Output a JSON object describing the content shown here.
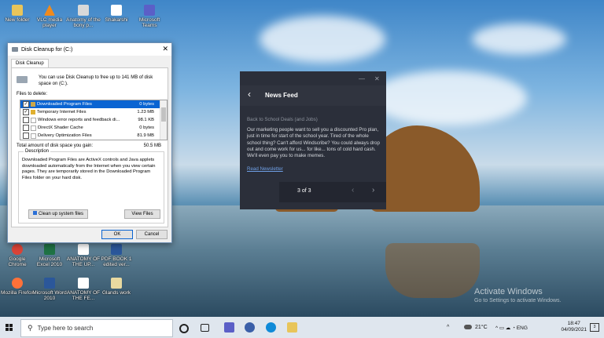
{
  "desktop": {
    "icons_row1": [
      {
        "label": "New folder",
        "color": "#e8c55a"
      },
      {
        "label": "VLC media player",
        "color": "#f08a1c"
      },
      {
        "label": "Anatomy of the bony p...",
        "color": "#d9d9d9"
      },
      {
        "label": "Shakarshi",
        "color": "#ffffff"
      },
      {
        "label": "Microsoft Teams",
        "color": "#5b5fc7"
      }
    ],
    "icons_row2": [
      {
        "label": "Google Chrome",
        "color": "#db4437"
      },
      {
        "label": "Microsoft Excel 2010",
        "color": "#1f7244"
      },
      {
        "label": "ANATOMY OF THE UP...",
        "color": "#ffffff"
      },
      {
        "label": "PDF BOOK 1 edited ver...",
        "color": "#2b579a"
      }
    ],
    "icons_row3": [
      {
        "label": "Mozilla Firefox",
        "color": "#ff7139"
      },
      {
        "label": "Microsoft Word 2010",
        "color": "#2b579a"
      },
      {
        "label": "ANATOMY OF THE FE...",
        "color": "#ffffff"
      },
      {
        "label": "Glands work",
        "color": "#e8d9a0"
      }
    ],
    "activate_title": "Activate Windows",
    "activate_sub": "Go to Settings to activate Windows."
  },
  "disk_cleanup": {
    "title": "Disk Cleanup for  (C:)",
    "tab": "Disk Cleanup",
    "intro": "You can use Disk Cleanup to free up to 141 MB of disk space on  (C:).",
    "files_label": "Files to delete:",
    "files": [
      {
        "name": "Downloaded Program Files",
        "size": "0 bytes",
        "checked": "✓"
      },
      {
        "name": "Temporary Internet Files",
        "size": "1.23 MB",
        "checked": "✓"
      },
      {
        "name": "Windows error reports and feedback di...",
        "size": "98.1 KB",
        "checked": ""
      },
      {
        "name": "DirectX Shader Cache",
        "size": "0 bytes",
        "checked": ""
      },
      {
        "name": "Delivery Optimization Files",
        "size": "81.9 MB",
        "checked": ""
      }
    ],
    "total_label": "Total amount of disk space you gain:",
    "total_value": "50.5 MB",
    "description_label": "Description",
    "description": "Downloaded Program Files are ActiveX controls and Java applets downloaded automatically from the Internet when you view certain pages. They are temporarily stored in the Downloaded Program Files folder on your hard disk.",
    "cleanup_button": "Clean up system files",
    "view_button": "View Files",
    "ok_button": "OK",
    "cancel_button": "Cancel",
    "close_glyph": "✕"
  },
  "news": {
    "title": "News Feed",
    "back_glyph": "‹",
    "minimize_glyph": "—",
    "close_glyph": "✕",
    "subtitle": "Back to School Deals (and Jobs)",
    "body": "Our marketing people want to sell you a discounted Pro plan, just in time for start of the school year. Tired of the whole school thing? Can't afford Windscribe? You could always drop out and come work for us... for like... tons of cold hard cash. We'll even pay you to make memes.",
    "link": "Read Newsletter",
    "page": "3 of 3",
    "prev_glyph": "‹",
    "next_glyph": "›"
  },
  "taskbar": {
    "search_placeholder": "Type here to search",
    "search_glyph": "⚲",
    "weather": "21°C",
    "time": "18:47",
    "date": "04/09/2021",
    "notification_count": "3",
    "tray_glyphs": "^ ▭ ☁ ◔ ENG"
  }
}
